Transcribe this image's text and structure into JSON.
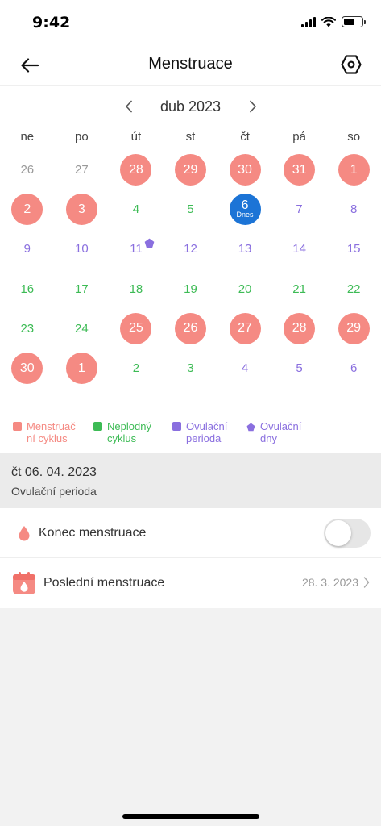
{
  "status_bar": {
    "time": "9:42"
  },
  "header": {
    "title": "Menstruace"
  },
  "calendar": {
    "month": "dub 2023",
    "weekdays": [
      "ne",
      "po",
      "út",
      "st",
      "čt",
      "pá",
      "so"
    ],
    "today_label": "Dnes",
    "weeks": [
      [
        {
          "d": "26",
          "t": "outside"
        },
        {
          "d": "27",
          "t": "outside"
        },
        {
          "d": "28",
          "t": "period"
        },
        {
          "d": "29",
          "t": "period"
        },
        {
          "d": "30",
          "t": "period"
        },
        {
          "d": "31",
          "t": "period"
        },
        {
          "d": "1",
          "t": "period"
        }
      ],
      [
        {
          "d": "2",
          "t": "period"
        },
        {
          "d": "3",
          "t": "period"
        },
        {
          "d": "4",
          "t": "infertile"
        },
        {
          "d": "5",
          "t": "infertile"
        },
        {
          "d": "6",
          "t": "today"
        },
        {
          "d": "7",
          "t": "ovulation"
        },
        {
          "d": "8",
          "t": "ovulation"
        }
      ],
      [
        {
          "d": "9",
          "t": "ovulation"
        },
        {
          "d": "10",
          "t": "ovulation"
        },
        {
          "d": "11",
          "t": "ovulation",
          "ovulation_day": true
        },
        {
          "d": "12",
          "t": "ovulation"
        },
        {
          "d": "13",
          "t": "ovulation"
        },
        {
          "d": "14",
          "t": "ovulation"
        },
        {
          "d": "15",
          "t": "ovulation"
        }
      ],
      [
        {
          "d": "16",
          "t": "infertile"
        },
        {
          "d": "17",
          "t": "infertile"
        },
        {
          "d": "18",
          "t": "infertile"
        },
        {
          "d": "19",
          "t": "infertile"
        },
        {
          "d": "20",
          "t": "infertile"
        },
        {
          "d": "21",
          "t": "infertile"
        },
        {
          "d": "22",
          "t": "infertile"
        }
      ],
      [
        {
          "d": "23",
          "t": "infertile"
        },
        {
          "d": "24",
          "t": "infertile"
        },
        {
          "d": "25",
          "t": "period"
        },
        {
          "d": "26",
          "t": "period"
        },
        {
          "d": "27",
          "t": "period"
        },
        {
          "d": "28",
          "t": "period"
        },
        {
          "d": "29",
          "t": "period"
        }
      ],
      [
        {
          "d": "30",
          "t": "period"
        },
        {
          "d": "1",
          "t": "period"
        },
        {
          "d": "2",
          "t": "infertile"
        },
        {
          "d": "3",
          "t": "infertile"
        },
        {
          "d": "4",
          "t": "ovulation"
        },
        {
          "d": "5",
          "t": "ovulation"
        },
        {
          "d": "6",
          "t": "ovulation"
        }
      ]
    ]
  },
  "legend": [
    {
      "label_line1": "Menstruač",
      "label_line2": "ní cyklus",
      "color": "#f58a83",
      "shape": "square"
    },
    {
      "label_line1": "Neplodný",
      "label_line2": "cyklus",
      "color": "#3dbb55",
      "shape": "square"
    },
    {
      "label_line1": "Ovulační",
      "label_line2": "perioda",
      "color": "#8a6fdf",
      "shape": "square"
    },
    {
      "label_line1": "Ovulační",
      "label_line2": "dny",
      "color": "#8a6fdf",
      "shape": "pentagon"
    }
  ],
  "selected_day": {
    "date": "čt 06. 04. 2023",
    "status": "Ovulační perioda"
  },
  "settings": {
    "end_menstruation": {
      "label": "Konec menstruace",
      "enabled": false,
      "icon": "drop-icon"
    },
    "last_menstruation": {
      "label": "Poslední menstruace",
      "value": "28. 3. 2023",
      "icon": "calendar-drop-icon"
    }
  },
  "colors": {
    "period": "#f58a83",
    "infertile": "#3dbb55",
    "ovulation": "#8a6fdf",
    "today": "#1c74d6"
  }
}
